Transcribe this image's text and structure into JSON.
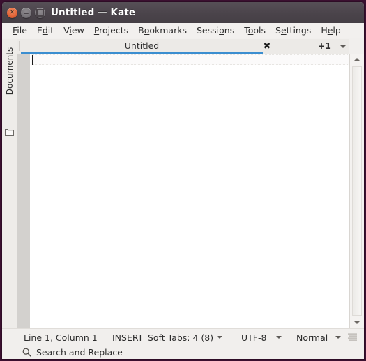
{
  "window": {
    "title": "Untitled — Kate",
    "controls": {
      "close": "close-button",
      "minimize": "minimize-button",
      "maximize": "maximize-button"
    }
  },
  "menubar": {
    "items": [
      {
        "label": "File",
        "accel_index": 0
      },
      {
        "label": "Edit",
        "accel_index": 1
      },
      {
        "label": "View",
        "accel_index": 1
      },
      {
        "label": "Projects",
        "accel_index": 0
      },
      {
        "label": "Bookmarks",
        "accel_index": 1
      },
      {
        "label": "Sessions",
        "accel_index": 5
      },
      {
        "label": "Tools",
        "accel_index": 1
      },
      {
        "label": "Settings",
        "accel_index": 1
      },
      {
        "label": "Help",
        "accel_index": 1
      }
    ]
  },
  "tabbar": {
    "active_tab": "Untitled",
    "close_glyph": "✖",
    "overflow_label": "+1",
    "accent_color": "#3b8ed0"
  },
  "sidebar": {
    "tabs": [
      {
        "label": "Documents",
        "icon": "folder-icon"
      }
    ]
  },
  "editor": {
    "content": "",
    "caret": "visible"
  },
  "statusbar": {
    "position": "Line 1, Column 1",
    "input_mode": "INSERT",
    "tabs": "Soft Tabs: 4 (8)",
    "encoding": "UTF-8",
    "highlight_mode": "Normal"
  },
  "searchbar": {
    "label": "Search and Replace",
    "icon": "search-icon"
  },
  "colors": {
    "desktop": "#3b1030",
    "titlebar": "#4b444b",
    "chrome": "#f1efed",
    "accent": "#3b8ed0",
    "close_button": "#e4663a"
  }
}
